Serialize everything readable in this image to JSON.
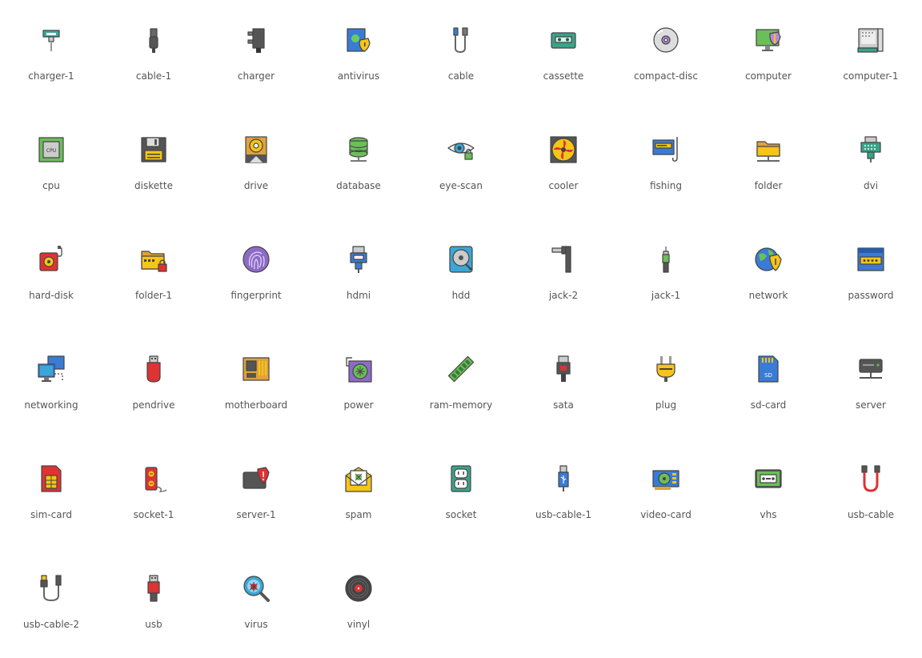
{
  "icons": [
    {
      "label": "charger-1",
      "name": "charger-1-icon"
    },
    {
      "label": "cable-1",
      "name": "cable-1-icon"
    },
    {
      "label": "charger",
      "name": "charger-icon"
    },
    {
      "label": "antivirus",
      "name": "antivirus-icon"
    },
    {
      "label": "cable",
      "name": "cable-icon"
    },
    {
      "label": "cassette",
      "name": "cassette-icon"
    },
    {
      "label": "compact-disc",
      "name": "compact-disc-icon"
    },
    {
      "label": "computer",
      "name": "computer-icon"
    },
    {
      "label": "computer-1",
      "name": "computer-1-icon"
    },
    {
      "label": "cpu",
      "name": "cpu-icon",
      "text": "CPU"
    },
    {
      "label": "diskette",
      "name": "diskette-icon"
    },
    {
      "label": "drive",
      "name": "drive-icon"
    },
    {
      "label": "database",
      "name": "database-icon"
    },
    {
      "label": "eye-scan",
      "name": "eye-scan-icon"
    },
    {
      "label": "cooler",
      "name": "cooler-icon"
    },
    {
      "label": "fishing",
      "name": "fishing-icon"
    },
    {
      "label": "folder",
      "name": "folder-icon"
    },
    {
      "label": "dvi",
      "name": "dvi-icon"
    },
    {
      "label": "hard-disk",
      "name": "hard-disk-icon"
    },
    {
      "label": "folder-1",
      "name": "folder-1-icon"
    },
    {
      "label": "fingerprint",
      "name": "fingerprint-icon"
    },
    {
      "label": "hdmi",
      "name": "hdmi-icon"
    },
    {
      "label": "hdd",
      "name": "hdd-icon"
    },
    {
      "label": "jack-2",
      "name": "jack-2-icon"
    },
    {
      "label": "jack-1",
      "name": "jack-1-icon"
    },
    {
      "label": "network",
      "name": "network-icon"
    },
    {
      "label": "password",
      "name": "password-icon"
    },
    {
      "label": "networking",
      "name": "networking-icon"
    },
    {
      "label": "pendrive",
      "name": "pendrive-icon"
    },
    {
      "label": "motherboard",
      "name": "motherboard-icon"
    },
    {
      "label": "power",
      "name": "power-icon"
    },
    {
      "label": "ram-memory",
      "name": "ram-memory-icon"
    },
    {
      "label": "sata",
      "name": "sata-icon"
    },
    {
      "label": "plug",
      "name": "plug-icon"
    },
    {
      "label": "sd-card",
      "name": "sd-card-icon",
      "text": "SD"
    },
    {
      "label": "server",
      "name": "server-icon"
    },
    {
      "label": "sim-card",
      "name": "sim-card-icon"
    },
    {
      "label": "socket-1",
      "name": "socket-1-icon"
    },
    {
      "label": "server-1",
      "name": "server-1-icon"
    },
    {
      "label": "spam",
      "name": "spam-icon"
    },
    {
      "label": "socket",
      "name": "socket-icon"
    },
    {
      "label": "usb-cable-1",
      "name": "usb-cable-1-icon"
    },
    {
      "label": "video-card",
      "name": "video-card-icon"
    },
    {
      "label": "vhs",
      "name": "vhs-icon"
    },
    {
      "label": "usb-cable",
      "name": "usb-cable-icon"
    },
    {
      "label": "usb-cable-2",
      "name": "usb-cable-2-icon"
    },
    {
      "label": "usb",
      "name": "usb-icon"
    },
    {
      "label": "virus",
      "name": "virus-icon"
    },
    {
      "label": "vinyl",
      "name": "vinyl-icon"
    }
  ]
}
